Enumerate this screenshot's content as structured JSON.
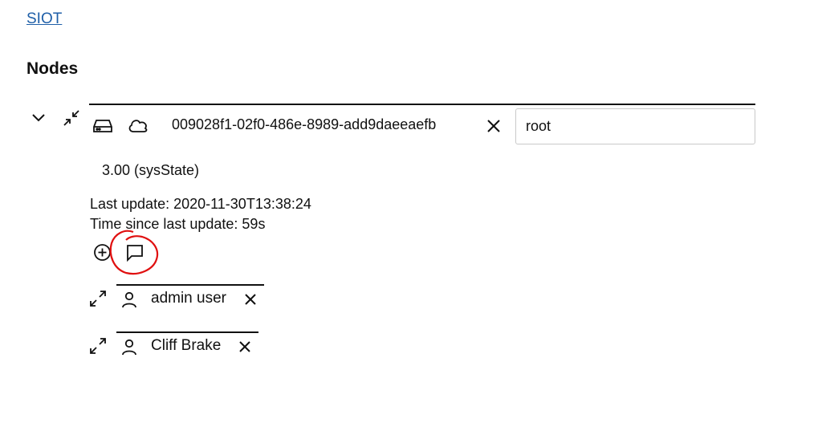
{
  "header": {
    "home_link": "SIOT"
  },
  "page": {
    "title": "Nodes"
  },
  "node": {
    "id": "009028f1-02f0-486e-8989-add9daeeaefb",
    "name_input_value": "root",
    "sys_state": "3.00 (sysState)",
    "last_update": "Last update: 2020-11-30T13:38:24",
    "time_since_update": "Time since last update: 59s",
    "icons": [
      "chevron-down-icon",
      "collapse-arrows-icon",
      "device-icon",
      "cloud-icon",
      "close-icon",
      "add-circle-icon",
      "message-icon"
    ]
  },
  "children": [
    {
      "name": "admin user",
      "icons": [
        "expand-arrows-icon",
        "user-icon",
        "close-icon"
      ]
    },
    {
      "name": "Cliff Brake",
      "icons": [
        "expand-arrows-icon",
        "user-icon",
        "close-icon"
      ]
    }
  ],
  "annotation": {
    "color": "#e01010",
    "shape": "freehand-circle"
  },
  "colors": {
    "link": "#1f5fa8",
    "text": "#111111",
    "input_border": "#c9c9c9"
  }
}
